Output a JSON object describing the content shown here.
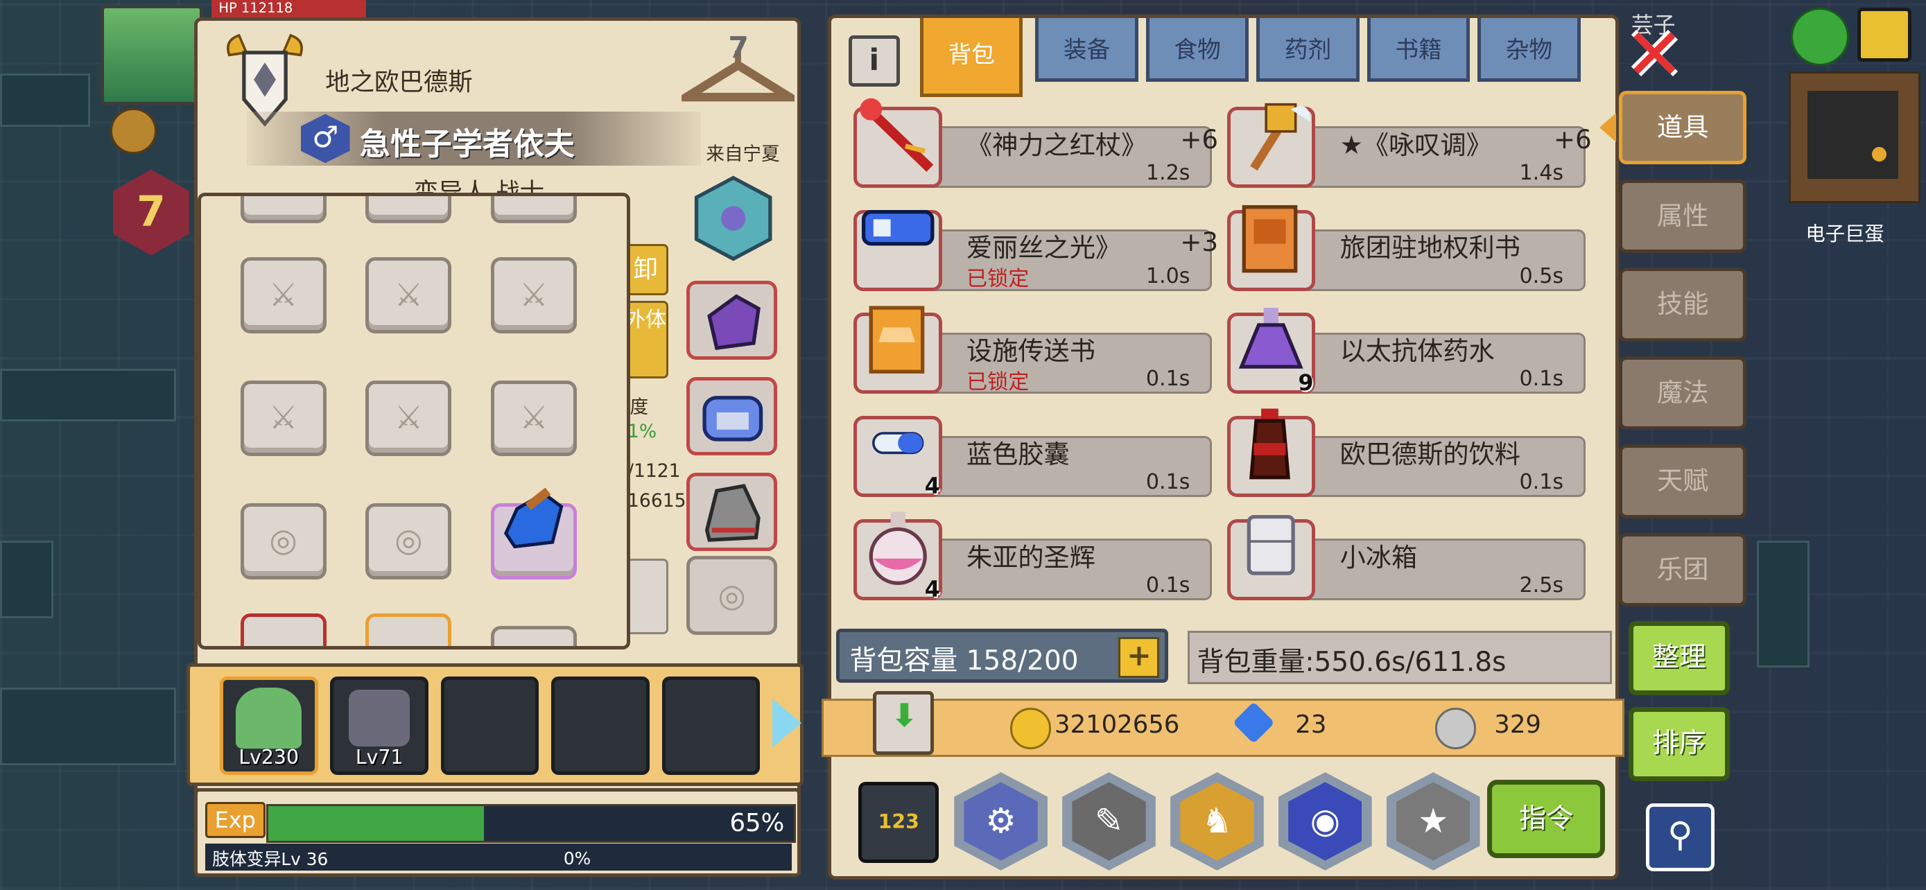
{
  "colors": {
    "accent": "#f0a830",
    "lock_red": "#c02020",
    "exp_green": "#3fa844"
  },
  "hud": {
    "hp_label": "HP 112118",
    "level_badge": "7",
    "minimap_label": "电子巨蛋",
    "top_partial": "芸子"
  },
  "character": {
    "location": "地之欧巴德斯",
    "name": "急性子学者依夫",
    "gender_icon": "male-symbol",
    "origin": "来自宁夏",
    "race_partial": "变异人 战士",
    "hanger_count": "7",
    "side_buttons": [
      "卸",
      "外体"
    ],
    "partial_stats": [
      "度",
      "1%",
      "/1121",
      "16615"
    ]
  },
  "party": [
    {
      "level": "Lv230",
      "selected": true
    },
    {
      "level": "Lv71",
      "selected": false
    },
    {
      "level": ""
    },
    {
      "level": ""
    },
    {
      "level": ""
    }
  ],
  "exp": {
    "tag": "Exp",
    "progress": 65,
    "percent_label": "65%",
    "mutation_label": "肢体变异Lv 36",
    "mutation_percent": "0%"
  },
  "inventory": {
    "tabs": [
      "背包",
      "装备",
      "食物",
      "药剂",
      "书籍",
      "杂物"
    ],
    "active_tab": 0,
    "items": [
      {
        "name": "《神力之红杖》",
        "plus": "+6",
        "time": "1.2s",
        "locked": "",
        "count": "",
        "art": "red-staff"
      },
      {
        "name": "★《咏叹调》",
        "plus": "+6",
        "time": "1.4s",
        "locked": "",
        "count": "",
        "art": "winged-mace"
      },
      {
        "name": "爱丽丝之光》",
        "plus": "+3",
        "time": "1.0s",
        "locked": "已锁定",
        "count": "",
        "art": "blue-battery"
      },
      {
        "name": "旅团驻地权利书",
        "plus": "",
        "time": "0.5s",
        "locked": "",
        "count": "",
        "art": "orange-book"
      },
      {
        "name": "设施传送书",
        "plus": "",
        "time": "0.1s",
        "locked": "已锁定",
        "count": "",
        "art": "orange-scroll"
      },
      {
        "name": "以太抗体药水",
        "plus": "",
        "time": "0.1s",
        "locked": "",
        "count": "9",
        "art": "purple-flask"
      },
      {
        "name": "蓝色胶囊",
        "plus": "",
        "time": "0.1s",
        "locked": "",
        "count": "4",
        "art": "blue-capsule"
      },
      {
        "name": "欧巴德斯的饮料",
        "plus": "",
        "time": "0.1s",
        "locked": "",
        "count": "",
        "art": "cola-bottle"
      },
      {
        "name": "朱亚的圣辉",
        "plus": "",
        "time": "0.1s",
        "locked": "",
        "count": "4",
        "art": "pink-potion"
      },
      {
        "name": "小冰箱",
        "plus": "",
        "time": "2.5s",
        "locked": "",
        "count": "",
        "art": "mini-fridge"
      }
    ],
    "capacity_label": "背包容量 158/200",
    "weight_label": "背包重量:550.6s/611.8s",
    "currency": {
      "gold": "32102656",
      "diamond": "23",
      "silver": "329"
    },
    "command_label": "指令",
    "number_btn_label": "123"
  },
  "side_menu": {
    "items": [
      "道具",
      "属性",
      "技能",
      "魔法",
      "天赋",
      "乐团"
    ],
    "active": 0,
    "sort_label": "整理",
    "order_label": "排序"
  }
}
